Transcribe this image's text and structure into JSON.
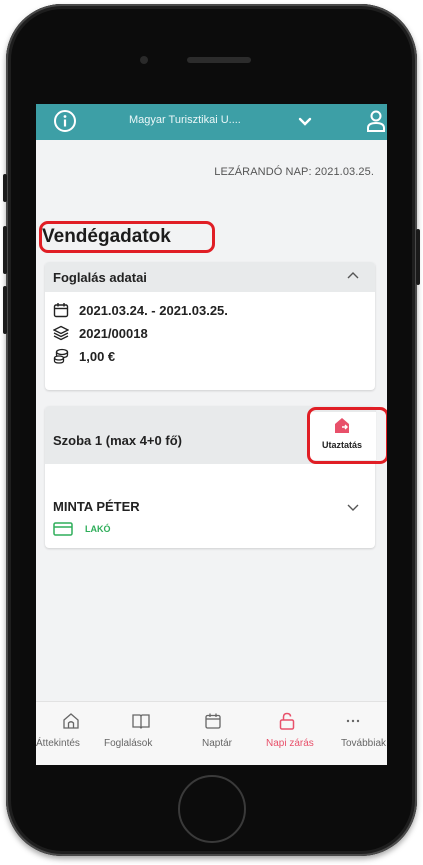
{
  "header": {
    "organization": "Magyar Turisztikai U....",
    "closing_date_label": "LEZÁRANDÓ NAP: 2021.03.25."
  },
  "page": {
    "title": "Vendégadatok"
  },
  "booking": {
    "section_label": "Foglalás adatai",
    "dates": "2021.03.24. - 2021.03.25.",
    "booking_number": "2021/00018",
    "amount": "1,00 €"
  },
  "room": {
    "label": "Szoba 1 (max 4+0 fő)",
    "transport_label": "Utaztatás",
    "guest_name": "MINTA PÉTER",
    "guest_status": "LAKÓ"
  },
  "nav": {
    "items": [
      {
        "label": "Áttekintés",
        "icon": "home-icon"
      },
      {
        "label": "Foglalások",
        "icon": "book-icon"
      },
      {
        "label": "Naptár",
        "icon": "calendar-icon"
      },
      {
        "label": "Napi zárás",
        "icon": "unlock-icon",
        "active": true
      },
      {
        "label": "Továbbiak",
        "icon": "more-icon"
      }
    ]
  },
  "colors": {
    "header": "#3d9fa6",
    "active_nav": "#e8506a",
    "status_green": "#2fae5a",
    "highlight": "#e01e25"
  }
}
